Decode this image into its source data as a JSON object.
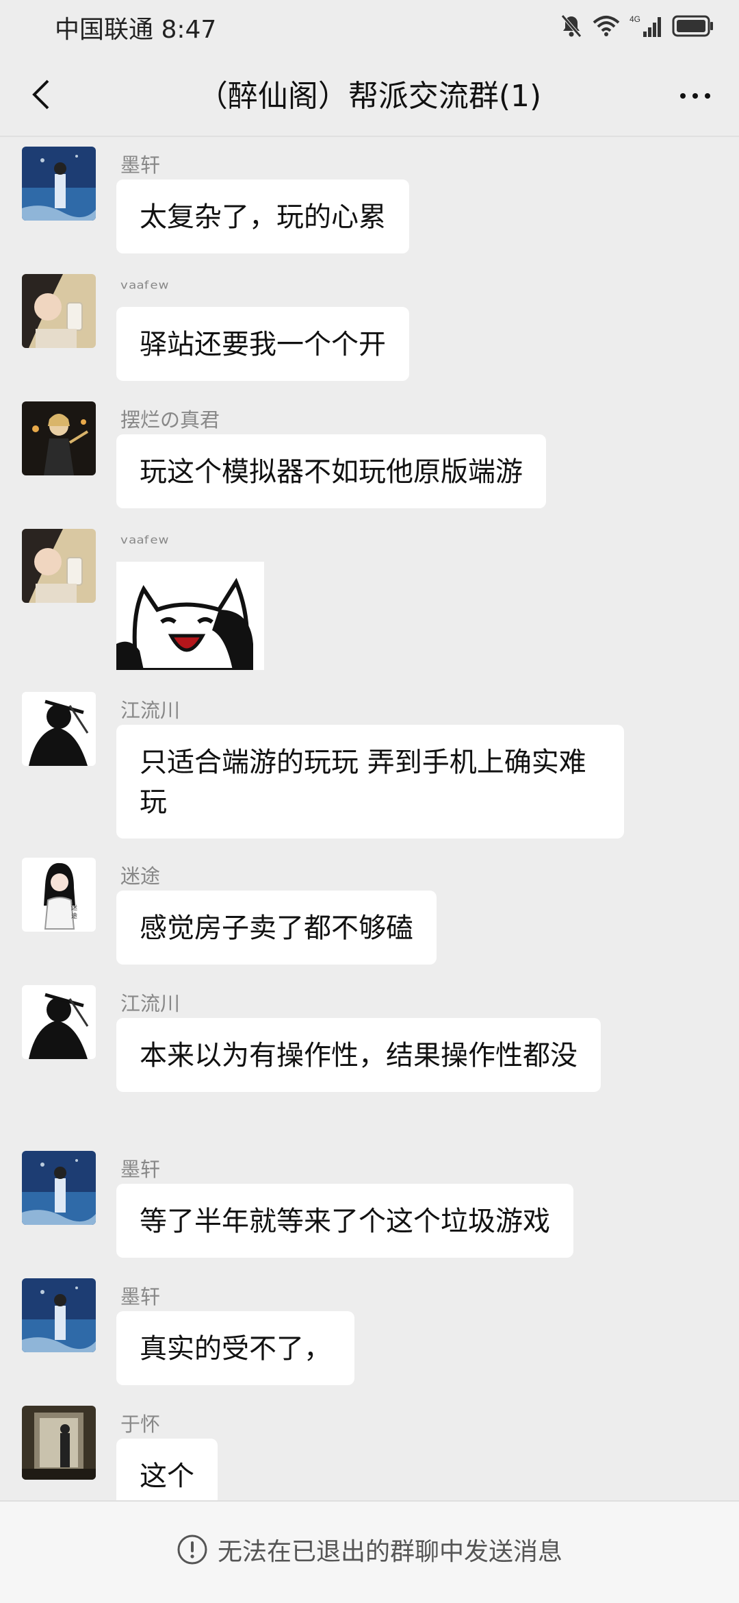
{
  "status_bar": {
    "carrier_time": "中国联通 8:47",
    "network_label": "4G"
  },
  "header": {
    "title": "（醉仙阁）帮派交流群(1)"
  },
  "messages": [
    {
      "sender": "墨轩",
      "text": "太复杂了，玩的心累"
    },
    {
      "sender": "ᵛᵃᵃᶠᵉʷ",
      "text": "驿站还要我一个个开"
    },
    {
      "sender": "摆烂の真君",
      "text": "玩这个模拟器不如玩他原版端游"
    },
    {
      "sender": "ᵛᵃᵃᶠᵉʷ",
      "sticker": "cat-sticker"
    },
    {
      "sender": "江流川",
      "text": "只适合端游的玩玩 弄到手机上确实难玩"
    },
    {
      "sender": "迷途",
      "text": "感觉房子卖了都不够磕"
    },
    {
      "sender": "江流川",
      "text": "本来以为有操作性，结果操作性都没"
    },
    {
      "sender": "墨轩",
      "text": "等了半年就等来了个这个垃圾游戏"
    },
    {
      "sender": "墨轩",
      "text": "真实的受不了，"
    },
    {
      "sender": "于怀",
      "text": "这个"
    }
  ],
  "footer": {
    "notice": "无法在已退出的群聊中发送消息"
  },
  "colors": {
    "background": "#ededed",
    "bubble": "#ffffff",
    "sender_text": "#888888"
  }
}
